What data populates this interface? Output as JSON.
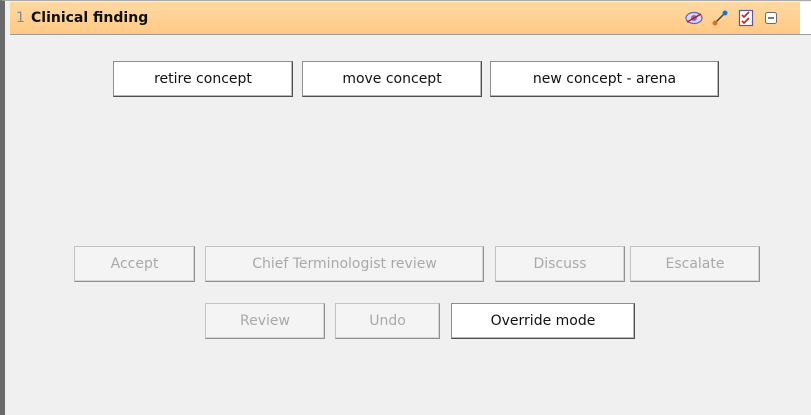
{
  "panel": {
    "index": "1",
    "title": "Clinical finding",
    "accent_color": "#ffc985",
    "icons": [
      "view-icon",
      "link-icon",
      "checklist-icon",
      "collapse-icon"
    ]
  },
  "top_actions": {
    "retire": "retire concept",
    "move": "move concept",
    "new_concept": "new concept - arena"
  },
  "workflow": {
    "accept": "Accept",
    "chief_review": "Chief Terminologist review",
    "discuss": "Discuss",
    "escalate": "Escalate",
    "review": "Review",
    "undo": "Undo",
    "override": "Override mode"
  }
}
